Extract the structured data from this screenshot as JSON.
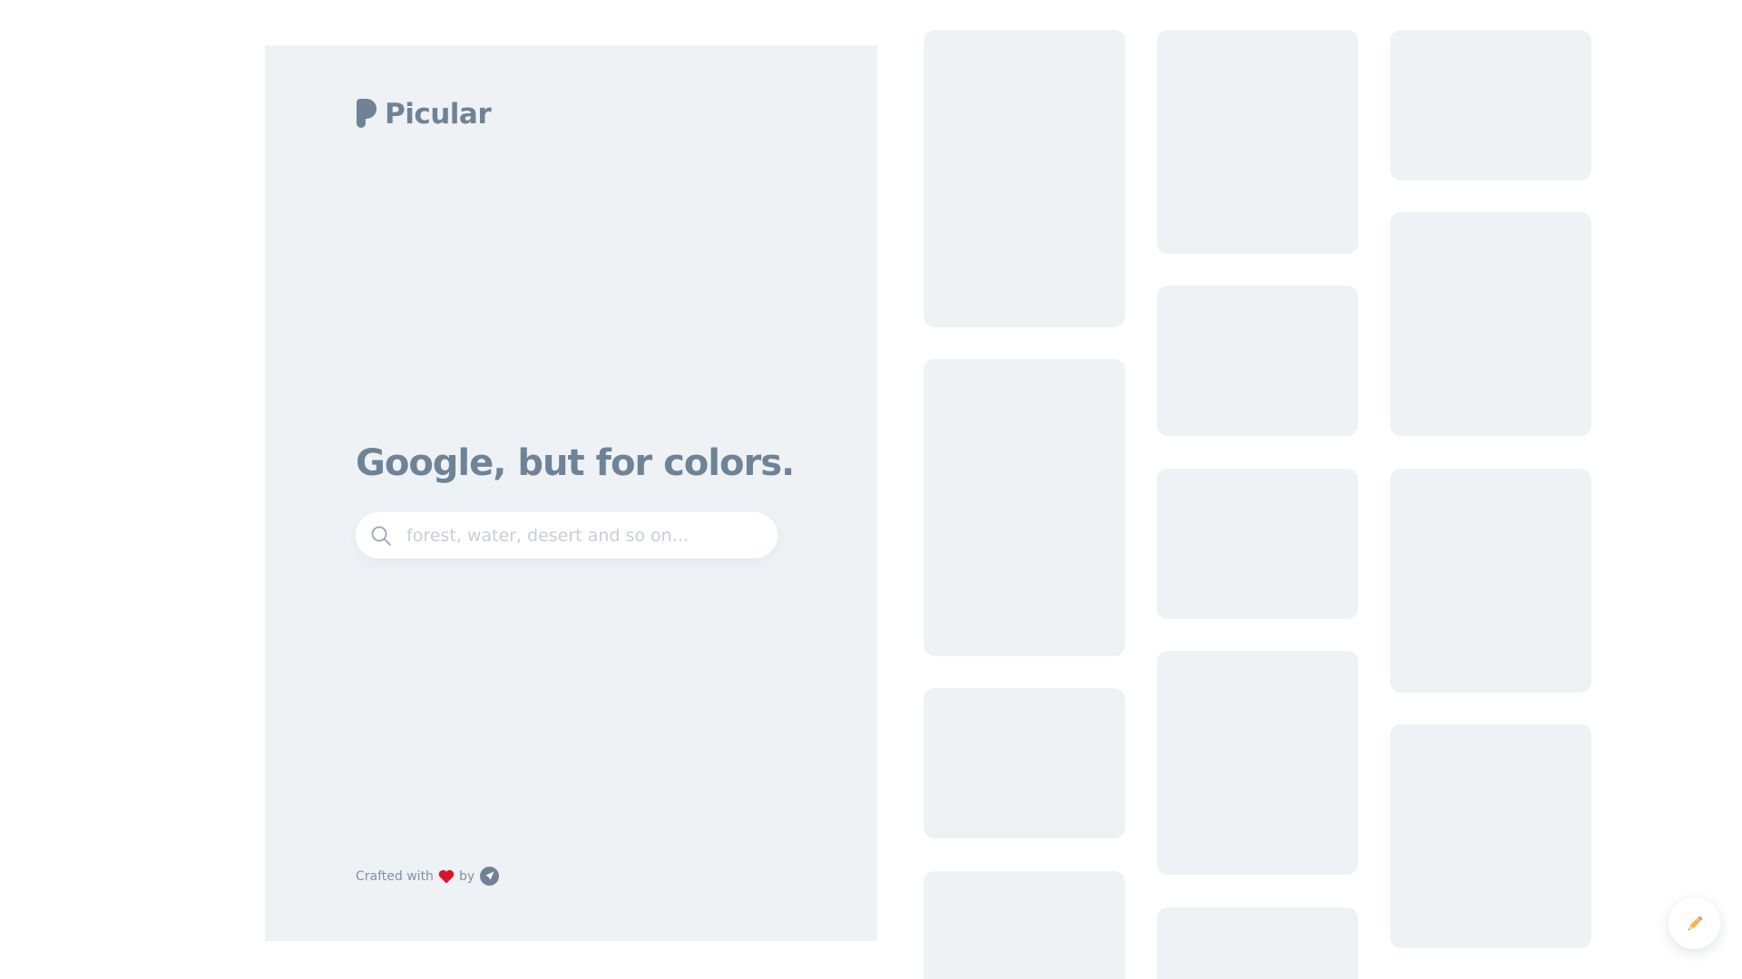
{
  "brand": {
    "name": "Picular",
    "logo_icon": "picular-logo-icon",
    "color": "#6e8396"
  },
  "hero": {
    "headline": "Google, but for colors.",
    "search": {
      "placeholder": "forest, water, desert and so on...",
      "value": "",
      "icon": "search-icon"
    },
    "credits": {
      "prefix": "Crafted with",
      "heart_icon": "heart-icon",
      "middle": "by",
      "maker_icon": "rocket-icon"
    }
  },
  "colors": {
    "panel_background": "#eff2f5",
    "tile_placeholder": "#eff2f5",
    "heart": "#e0112b",
    "text_muted": "#7f91a2",
    "placeholder_text": "#c7cfd7"
  },
  "results_grid": {
    "state": "loading",
    "columns": 3
  },
  "floating_button": {
    "icon": "pencil-icon"
  }
}
